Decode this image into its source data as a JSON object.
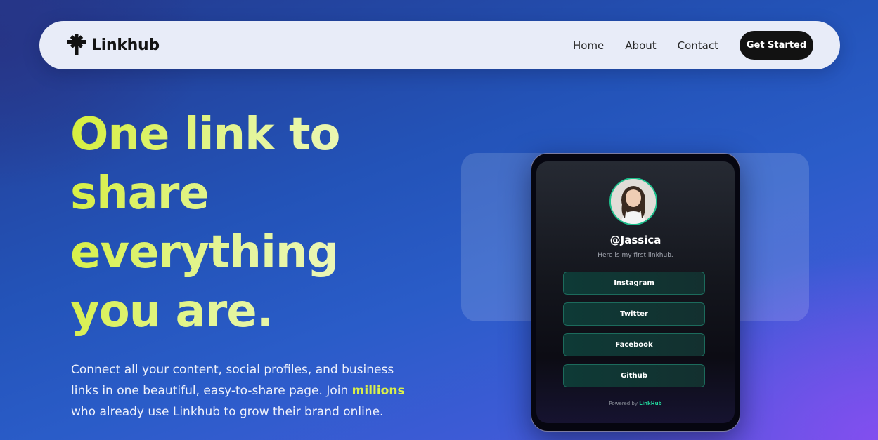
{
  "nav": {
    "brand": "Linkhub",
    "links": [
      "Home",
      "About",
      "Contact"
    ],
    "cta": "Get Started"
  },
  "hero": {
    "title": "One link to share everything you are.",
    "sub_before": "Connect all your content, social profiles, and business links in one beautiful, easy-to-share page. Join ",
    "sub_highlight": "millions",
    "sub_after": " who already use Linkhub to grow their brand online."
  },
  "profile": {
    "handle": "@Jassica",
    "bio": "Here is my first linkhub.",
    "links": [
      "Instagram",
      "Twitter",
      "Facebook",
      "Github"
    ],
    "powered_prefix": "Powered by",
    "powered_brand": "LinkHub"
  },
  "colors": {
    "accent": "#d6ef3c",
    "cta_bg": "#121212",
    "link_border": "#1c6b5c",
    "avatar_ring": "#1ec08d"
  },
  "icons": {
    "brand": "asterisk-logo-icon"
  }
}
